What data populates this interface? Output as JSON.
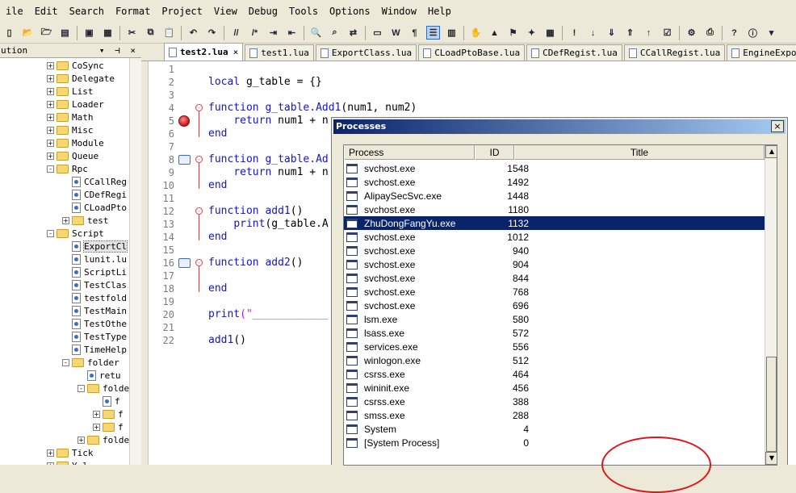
{
  "menu": [
    "ile",
    "Edit",
    "Search",
    "Format",
    "Project",
    "View",
    "Debug",
    "Tools",
    "Options",
    "Window",
    "Help"
  ],
  "toolbar_icons": [
    "new-file-icon",
    "open-icon",
    "open-folder-icon",
    "open-recent-icon",
    "save-icon",
    "save-all-icon",
    "cut-icon",
    "copy-icon",
    "paste-icon",
    "undo-icon",
    "redo-icon",
    "comment-icon",
    "uncomment-icon",
    "indent-icon",
    "outdent-icon",
    "find-icon",
    "find-next-icon",
    "replace-icon",
    "toggle-output-icon",
    "word-wrap-icon",
    "paragraph-icon",
    "line-number-icon",
    "column-icon",
    "hand-icon",
    "run-icon",
    "debug-run-icon",
    "stop-debug-icon",
    "calculator-icon",
    "breakpoint-icon",
    "step-over-icon",
    "step-into-icon",
    "step-out-icon",
    "step-return-icon",
    "watch-icon",
    "settings-icon",
    "print-icon",
    "help-icon",
    "about-icon",
    "more-icon"
  ],
  "solution": {
    "title": "ution",
    "buttons": "▾ ⊣ ×"
  },
  "tree": [
    {
      "label": "CoSync",
      "type": "folder",
      "indent": 0,
      "pm": "+"
    },
    {
      "label": "Delegate",
      "type": "folder",
      "indent": 0,
      "pm": "+"
    },
    {
      "label": "List",
      "type": "folder",
      "indent": 0,
      "pm": "+"
    },
    {
      "label": "Loader",
      "type": "folder",
      "indent": 0,
      "pm": "+"
    },
    {
      "label": "Math",
      "type": "folder",
      "indent": 0,
      "pm": "+"
    },
    {
      "label": "Misc",
      "type": "folder",
      "indent": 0,
      "pm": "+"
    },
    {
      "label": "Module",
      "type": "folder",
      "indent": 0,
      "pm": "+"
    },
    {
      "label": "Queue",
      "type": "folder",
      "indent": 0,
      "pm": "+"
    },
    {
      "label": "Rpc",
      "type": "folder",
      "indent": 0,
      "pm": "-"
    },
    {
      "label": "CCallReg",
      "type": "file",
      "indent": 1
    },
    {
      "label": "CDefRegi",
      "type": "file",
      "indent": 1
    },
    {
      "label": "CLoadPto",
      "type": "file",
      "indent": 1
    },
    {
      "label": "test",
      "type": "folder",
      "indent": 1,
      "pm": "+"
    },
    {
      "label": "Script",
      "type": "folder",
      "indent": 0,
      "pm": "-"
    },
    {
      "label": "ExportCl",
      "type": "file",
      "indent": 1,
      "selected": true
    },
    {
      "label": "lunit.lu",
      "type": "file",
      "indent": 1
    },
    {
      "label": "ScriptLi",
      "type": "file",
      "indent": 1
    },
    {
      "label": "TestClas",
      "type": "file",
      "indent": 1
    },
    {
      "label": "testfold",
      "type": "file",
      "indent": 1
    },
    {
      "label": "TestMain",
      "type": "file",
      "indent": 1
    },
    {
      "label": "TestOthe",
      "type": "file",
      "indent": 1
    },
    {
      "label": "TestType",
      "type": "file",
      "indent": 1
    },
    {
      "label": "TimeHelp",
      "type": "file",
      "indent": 1
    },
    {
      "label": "folder",
      "type": "folder",
      "indent": 1,
      "pm": "-"
    },
    {
      "label": "retu",
      "type": "file",
      "indent": 2
    },
    {
      "label": "folde",
      "type": "folder",
      "indent": 2,
      "pm": "-"
    },
    {
      "label": "f",
      "type": "file",
      "indent": 3
    },
    {
      "label": "f",
      "type": "folder",
      "indent": 3,
      "pm": "+"
    },
    {
      "label": "f",
      "type": "folder",
      "indent": 3,
      "pm": "+"
    },
    {
      "label": "folde",
      "type": "folder",
      "indent": 2,
      "pm": "+"
    },
    {
      "label": "Tick",
      "type": "folder",
      "indent": 0,
      "pm": "+"
    },
    {
      "label": "Y-l",
      "type": "folder",
      "indent": 0,
      "pm": "+"
    }
  ],
  "tabs": [
    {
      "label": "test2.lua",
      "active": true,
      "close": "×"
    },
    {
      "label": "test1.lua"
    },
    {
      "label": "ExportClass.lua"
    },
    {
      "label": "CLoadPtoBase.lua"
    },
    {
      "label": "CDefRegist.lua"
    },
    {
      "label": "CCallRegist.lua"
    },
    {
      "label": "EngineExport.lua"
    }
  ],
  "code_lines": [
    {
      "n": "1",
      "parts": []
    },
    {
      "n": "2",
      "parts": [
        {
          "t": "local",
          "c": "kw"
        },
        {
          "t": " g_table = {}"
        }
      ]
    },
    {
      "n": "3",
      "parts": []
    },
    {
      "n": "4",
      "parts": [
        {
          "t": "function",
          "c": "kw"
        },
        {
          "t": " g_table.Add1",
          "c": "fn"
        },
        {
          "t": "(num1, num2)"
        }
      ],
      "fold": "-"
    },
    {
      "n": "5",
      "parts": [
        {
          "t": "    "
        },
        {
          "t": "return",
          "c": "kw"
        },
        {
          "t": " num1 + n"
        }
      ],
      "marker": "breakpoint"
    },
    {
      "n": "6",
      "parts": [
        {
          "t": "end",
          "c": "kw"
        }
      ]
    },
    {
      "n": "7",
      "parts": []
    },
    {
      "n": "8",
      "parts": [
        {
          "t": "function",
          "c": "kw"
        },
        {
          "t": " g_table.Ad",
          "c": "fn"
        }
      ],
      "fold": "-",
      "marker": "bookmark"
    },
    {
      "n": "9",
      "parts": [
        {
          "t": "    "
        },
        {
          "t": "return",
          "c": "kw"
        },
        {
          "t": " num1 + n"
        }
      ]
    },
    {
      "n": "10",
      "parts": [
        {
          "t": "end",
          "c": "kw"
        }
      ]
    },
    {
      "n": "11",
      "parts": []
    },
    {
      "n": "12",
      "parts": [
        {
          "t": "function",
          "c": "kw"
        },
        {
          "t": " add1",
          "c": "fn"
        },
        {
          "t": "()"
        }
      ],
      "fold": "-"
    },
    {
      "n": "13",
      "parts": [
        {
          "t": "    "
        },
        {
          "t": "print",
          "c": "fn"
        },
        {
          "t": "(g_table.A"
        }
      ]
    },
    {
      "n": "14",
      "parts": [
        {
          "t": "end",
          "c": "kw"
        }
      ]
    },
    {
      "n": "15",
      "parts": []
    },
    {
      "n": "16",
      "parts": [
        {
          "t": "function",
          "c": "kw"
        },
        {
          "t": " add2",
          "c": "fn"
        },
        {
          "t": "()"
        }
      ],
      "fold": "-",
      "marker": "bookmark"
    },
    {
      "n": "17",
      "parts": []
    },
    {
      "n": "18",
      "parts": [
        {
          "t": "end",
          "c": "kw"
        }
      ]
    },
    {
      "n": "19",
      "parts": []
    },
    {
      "n": "20",
      "parts": [
        {
          "t": "print",
          "c": "fn"
        },
        {
          "t": "(\"____________",
          "c": "str"
        }
      ]
    },
    {
      "n": "21",
      "parts": []
    },
    {
      "n": "22",
      "parts": [
        {
          "t": "add1",
          "c": "fn"
        },
        {
          "t": "()"
        }
      ]
    }
  ],
  "processes": {
    "title": "Processes",
    "close": "×",
    "columns": {
      "process": "Process",
      "id": "ID",
      "title": "Title"
    },
    "rows": [
      {
        "name": "svchost.exe",
        "id": "1548"
      },
      {
        "name": "svchost.exe",
        "id": "1492"
      },
      {
        "name": "AlipaySecSvc.exe",
        "id": "1448"
      },
      {
        "name": "svchost.exe",
        "id": "1180"
      },
      {
        "name": "ZhuDongFangYu.exe",
        "id": "1132",
        "selected": true
      },
      {
        "name": "svchost.exe",
        "id": "1012"
      },
      {
        "name": "svchost.exe",
        "id": "940"
      },
      {
        "name": "svchost.exe",
        "id": "904"
      },
      {
        "name": "svchost.exe",
        "id": "844"
      },
      {
        "name": "svchost.exe",
        "id": "768"
      },
      {
        "name": "svchost.exe",
        "id": "696"
      },
      {
        "name": "lsm.exe",
        "id": "580"
      },
      {
        "name": "lsass.exe",
        "id": "572"
      },
      {
        "name": "services.exe",
        "id": "556"
      },
      {
        "name": "winlogon.exe",
        "id": "512"
      },
      {
        "name": "csrss.exe",
        "id": "464"
      },
      {
        "name": "wininit.exe",
        "id": "456"
      },
      {
        "name": "csrss.exe",
        "id": "388"
      },
      {
        "name": "smss.exe",
        "id": "288"
      },
      {
        "name": "System",
        "id": "4"
      },
      {
        "name": "[System Process]",
        "id": "0"
      }
    ],
    "scroll_up": "▲",
    "scroll_down": "▼"
  },
  "colors": {
    "selection": "#0a246a",
    "title_gradient_end": "#a6caf0",
    "keyword": "#1414c8",
    "string": "#c81ac8",
    "annotation": "#e0141a"
  }
}
